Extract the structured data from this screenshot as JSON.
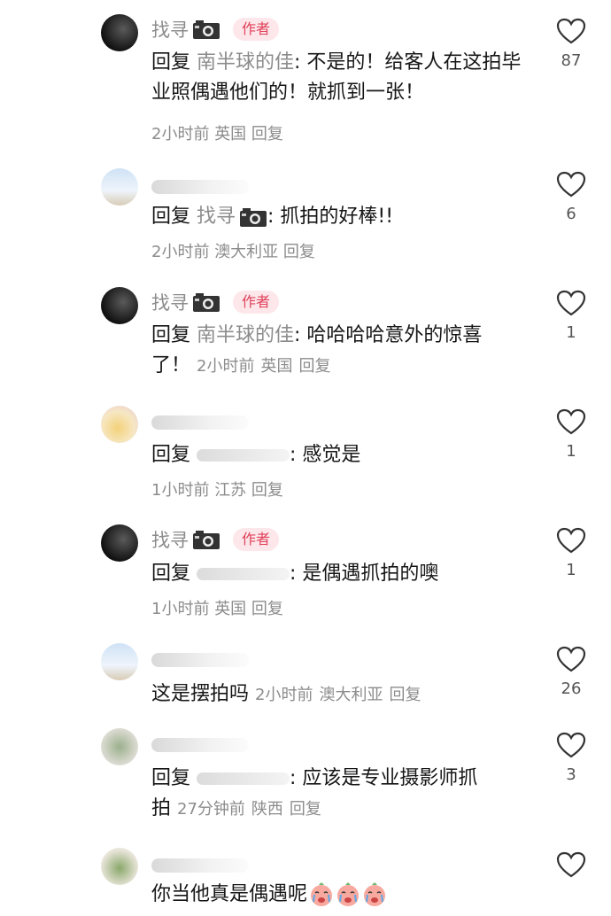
{
  "comments": [
    {
      "name": "找寻",
      "author_badge": "作者",
      "reply_keyword": "回复",
      "reply_target": "南半球的佳",
      "text": ": 不是的！给客人在这拍毕业照偶遇他们的！就抓到一张！",
      "time": "2小时前",
      "location": "英国",
      "reply_link": "回复",
      "likes": "87"
    },
    {
      "reply_keyword": "回复",
      "reply_target": "找寻",
      "text": ": 抓拍的好棒!!",
      "time": "2小时前",
      "location": "澳大利亚",
      "reply_link": "回复",
      "likes": "6"
    },
    {
      "name": "找寻",
      "author_badge": "作者",
      "reply_keyword": "回复",
      "reply_target": "南半球的佳",
      "text": ": 哈哈哈哈意外的惊喜",
      "text2": "了！",
      "time": "2小时前",
      "location": "英国",
      "reply_link": "回复",
      "likes": "1"
    },
    {
      "reply_keyword": "回复",
      "text": ": 感觉是",
      "time": "1小时前",
      "location": "江苏",
      "reply_link": "回复",
      "likes": "1"
    },
    {
      "name": "找寻",
      "author_badge": "作者",
      "reply_keyword": "回复",
      "text": ": 是偶遇抓拍的噢",
      "time": "1小时前",
      "location": "英国",
      "reply_link": "回复",
      "likes": "1"
    },
    {
      "text": "这是摆拍吗",
      "time": "2小时前",
      "location": "澳大利亚",
      "reply_link": "回复",
      "likes": "26"
    },
    {
      "reply_keyword": "回复",
      "text": ": 应该是专业摄影师抓",
      "text2": "拍",
      "time": "27分钟前",
      "location": "陕西",
      "reply_link": "回复",
      "likes": "3"
    },
    {
      "text": "你当他真是偶遇呢"
    }
  ],
  "colors": {
    "meta": "#8c8c8c",
    "author_badge_bg": "#fde7ea",
    "author_badge_text": "#e0405a"
  }
}
